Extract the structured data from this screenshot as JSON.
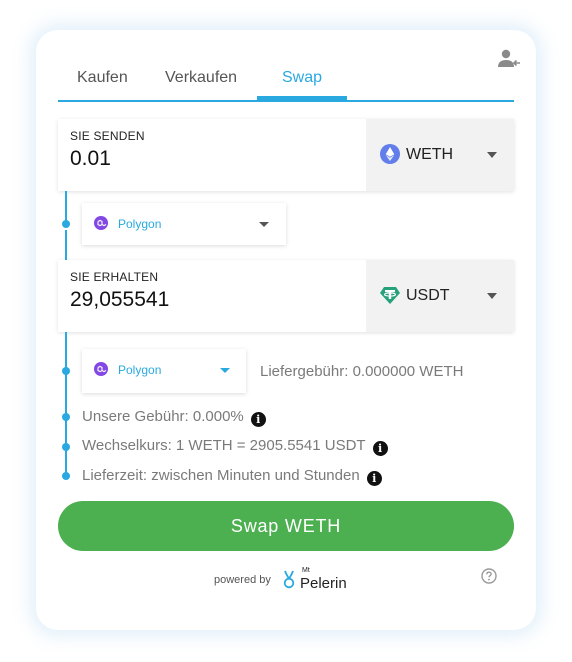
{
  "tabs": [
    {
      "label": "Kaufen"
    },
    {
      "label": "Verkaufen"
    },
    {
      "label": "Swap"
    }
  ],
  "send": {
    "label": "SIE SENDEN",
    "amount": "0.01",
    "token": "WETH",
    "token_icon": "ethereum-icon",
    "network": "Polygon"
  },
  "receive": {
    "label": "SIE ERHALTEN",
    "amount": "29,055541",
    "token": "USDT",
    "token_icon": "tether-icon",
    "network": "Polygon",
    "delivery_fee": "Liefergebühr: 0.000000 WETH"
  },
  "details": {
    "fee": "Unsere Gebühr: 0.000%",
    "rate": "Wechselkurs: 1 WETH = 2905.5541 USDT",
    "delivery_time": "Lieferzeit: zwischen Minuten und Stunden"
  },
  "swap_button": "Swap WETH",
  "footer": {
    "powered_by": "powered by",
    "brand_small": "Mt",
    "brand": "Pelerin"
  },
  "colors": {
    "accent": "#29a9e0",
    "button": "#4caf50",
    "ethereum": "#627eea",
    "tether": "#26a17b",
    "polygon": "#8247e5"
  }
}
